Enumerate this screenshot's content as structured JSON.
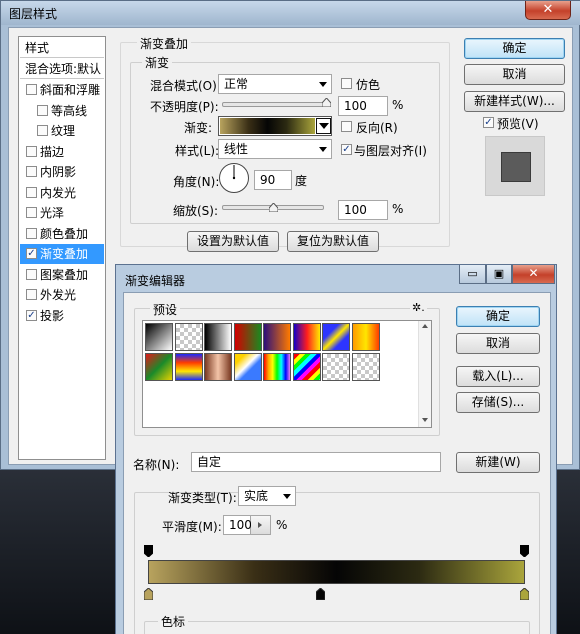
{
  "layer_style": {
    "title": "图层样式",
    "close_label": "✕",
    "style_list": {
      "header": "样式",
      "blend_header": "混合选项:默认",
      "items": [
        {
          "label": "斜面和浮雕",
          "checked": false,
          "indent": false,
          "selected": false
        },
        {
          "label": "等高线",
          "checked": false,
          "indent": true,
          "selected": false
        },
        {
          "label": "纹理",
          "checked": false,
          "indent": true,
          "selected": false
        },
        {
          "label": "描边",
          "checked": false,
          "indent": false,
          "selected": false
        },
        {
          "label": "内阴影",
          "checked": false,
          "indent": false,
          "selected": false
        },
        {
          "label": "内发光",
          "checked": false,
          "indent": false,
          "selected": false
        },
        {
          "label": "光泽",
          "checked": false,
          "indent": false,
          "selected": false
        },
        {
          "label": "颜色叠加",
          "checked": false,
          "indent": false,
          "selected": false
        },
        {
          "label": "渐变叠加",
          "checked": true,
          "indent": false,
          "selected": true
        },
        {
          "label": "图案叠加",
          "checked": false,
          "indent": false,
          "selected": false
        },
        {
          "label": "外发光",
          "checked": false,
          "indent": false,
          "selected": false
        },
        {
          "label": "投影",
          "checked": true,
          "indent": false,
          "selected": false
        }
      ]
    },
    "panel": {
      "section_title": "渐变叠加",
      "group_title": "渐变",
      "blend_mode_label": "混合模式(O):",
      "blend_mode_value": "正常",
      "dither_label": "仿色",
      "opacity_label": "不透明度(P):",
      "opacity_value": "100",
      "opacity_unit": "%",
      "opacity_level": 1.0,
      "gradient_label": "渐变:",
      "reverse_label": "反向(R)",
      "style_label": "样式(L):",
      "style_value": "线性",
      "align_label": "与图层对齐(I)",
      "align_checked": true,
      "angle_label": "角度(N):",
      "angle_value": "90",
      "angle_unit": "度",
      "scale_label": "缩放(S):",
      "scale_value": "100",
      "scale_unit": "%",
      "scale_level": 0.5,
      "make_default": "设置为默认值",
      "reset_default": "复位为默认值"
    },
    "buttons": {
      "ok": "确定",
      "cancel": "取消",
      "new_style": "新建样式(W)...",
      "preview": "预览(V)",
      "preview_checked": true
    }
  },
  "gradient_editor": {
    "title": "渐变编辑器",
    "minimize_label": "▭",
    "maximize_label": "▣",
    "close_label": "✕",
    "presets_label": "预设",
    "gear_label": "✲.",
    "buttons": {
      "ok": "确定",
      "cancel": "取消",
      "load": "载入(L)...",
      "save": "存储(S)...",
      "new": "新建(W)"
    },
    "name_label": "名称(N):",
    "name_value": "自定",
    "gradient_type_label": "渐变类型(T):",
    "gradient_type_value": "实底",
    "smoothness_label": "平滑度(M):",
    "smoothness_value": "100",
    "smoothness_unit": "%",
    "color_stops_label": "色标",
    "colors": {
      "gold_left": "#b8a35e",
      "gold_right": "#aaa53c",
      "black": "#050505"
    }
  }
}
